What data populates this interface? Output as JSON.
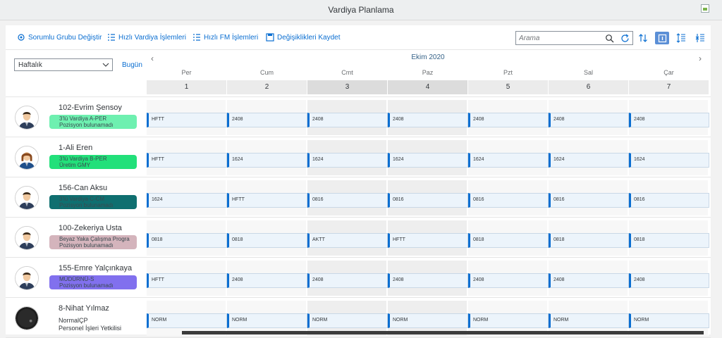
{
  "window": {
    "title": "Vardiya Planlama"
  },
  "toolbar": {
    "change_group": "Sorumlu Grubu Değiştir",
    "quick_shift": "Hızlı Vardiya İşlemleri",
    "quick_fm": "Hızlı FM İşlemleri",
    "save_changes": "Değişiklikleri Kaydet"
  },
  "search": {
    "placeholder": "Arama"
  },
  "calendar": {
    "view": "Haftalık",
    "today": "Bugün",
    "month": "Ekim 2020",
    "days": [
      {
        "name": "Per",
        "num": "1"
      },
      {
        "name": "Cum",
        "num": "2"
      },
      {
        "name": "Cmt",
        "num": "3"
      },
      {
        "name": "Paz",
        "num": "4"
      },
      {
        "name": "Pzt",
        "num": "5"
      },
      {
        "name": "Sal",
        "num": "6"
      },
      {
        "name": "Çar",
        "num": "7"
      }
    ]
  },
  "colors": {
    "accent": "#0a6ed1",
    "shift_bg": "#ecf4fb"
  },
  "employees": [
    {
      "name": "102-Evrim Şensoy",
      "line1": "3'lü Vardiya A-PER",
      "line2": "Pozisyon bulunamadı",
      "badge_color": "#6ef0b0",
      "avatar": "male-avatar-icon",
      "shifts": [
        "HFTT",
        "2408",
        "2408",
        "2408",
        "2408",
        "2408",
        "2408"
      ]
    },
    {
      "name": "1-Ali Eren",
      "line1": "3'lü Vardiya B-PER",
      "line2": "Üretim GMY",
      "badge_color": "#22e07a",
      "avatar": "female-avatar-icon",
      "shifts": [
        "HFTT",
        "1624",
        "1624",
        "1624",
        "1624",
        "1624",
        "1624"
      ]
    },
    {
      "name": "156-Can Aksu",
      "line1": "3'lü Vardiya C-CM",
      "line2": "Pozisyon bulunamadı",
      "badge_color": "#0f6f70",
      "avatar": "male-avatar-icon",
      "shifts": [
        "1624",
        "HFTT",
        "0816",
        "0816",
        "0816",
        "0816",
        "0816"
      ]
    },
    {
      "name": "100-Zekeriya Usta",
      "line1": "Beyaz Yaka Çalışma Progra",
      "line2": "Pozisyon bulunamadı",
      "badge_color": "#d4b4bc",
      "avatar": "male-avatar-icon",
      "shifts": [
        "0818",
        "0818",
        "AKTT",
        "HFTT",
        "0818",
        "0818",
        "0818"
      ]
    },
    {
      "name": "155-Emre Yalçınkaya",
      "line1": "MÜDÜRNÜ-S",
      "line2": "Pozisyon bulunamadı",
      "badge_color": "#8170ee",
      "avatar": "male-avatar-icon",
      "shifts": [
        "HFTT",
        "2408",
        "2408",
        "2408",
        "2408",
        "2408",
        "2408"
      ]
    },
    {
      "name": "8-Nihat Yılmaz",
      "line1": "NormalÇP",
      "line2": "Personel İşleri Yetkilisi",
      "badge_color": "",
      "avatar": "dark-avatar-icon",
      "shifts": [
        "NORM",
        "NORM",
        "NORM",
        "NORM",
        "NORM",
        "NORM",
        "NORM"
      ]
    }
  ]
}
